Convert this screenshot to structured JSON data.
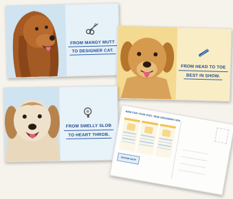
{
  "cards": [
    {
      "lines": [
        "FROM MANGY MUTT",
        "TO DESIGNER CAT."
      ],
      "icon": "scissors-icon"
    },
    {
      "lines": [
        "FROM HEAD TO TOE",
        "BEST IN SHOW."
      ],
      "icon": "comb-icon"
    },
    {
      "lines": [
        "FROM SMELLY SLOB",
        "TO HEART THROB."
      ],
      "icon": "dryer-icon"
    }
  ],
  "postcard": {
    "header": "NEW FOR YOUR DOG: NEW GROOMING SPA",
    "logo_text": "GROOM SHOP",
    "columns": 3
  },
  "colors": {
    "text_blue": "#1c4a8a",
    "card_blue": "#dcecf6",
    "card_yellow": "#f7e7b4",
    "accent_yellow": "#f2c14e"
  }
}
